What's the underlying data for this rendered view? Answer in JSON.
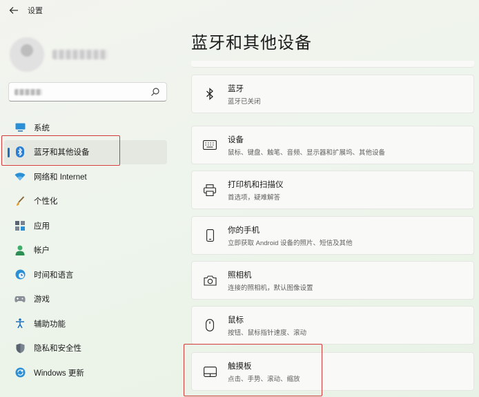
{
  "window": {
    "title": "设置"
  },
  "colors": {
    "accent": "#1f6fbf",
    "highlight": "#d23a3a"
  },
  "sidebar": {
    "profile": {
      "name": "·· :·:·.·.. ·",
      "avatar_icon": "user-avatar-icon"
    },
    "search": {
      "value": "··:·.·.··",
      "icon": "search-icon"
    },
    "items": [
      {
        "label": "系统",
        "icon": "display-icon",
        "active": false
      },
      {
        "label": "蓝牙和其他设备",
        "icon": "bluetooth-icon",
        "active": true
      },
      {
        "label": "网络和 Internet",
        "icon": "wifi-icon",
        "active": false
      },
      {
        "label": "个性化",
        "icon": "brush-icon",
        "active": false
      },
      {
        "label": "应用",
        "icon": "apps-icon",
        "active": false
      },
      {
        "label": "帐户",
        "icon": "account-icon",
        "active": false
      },
      {
        "label": "时间和语言",
        "icon": "globe-clock-icon",
        "active": false
      },
      {
        "label": "游戏",
        "icon": "gamepad-icon",
        "active": false
      },
      {
        "label": "辅助功能",
        "icon": "accessibility-icon",
        "active": false
      },
      {
        "label": "隐私和安全性",
        "icon": "shield-icon",
        "active": false
      },
      {
        "label": "Windows 更新",
        "icon": "update-icon",
        "active": false
      }
    ]
  },
  "main": {
    "title": "蓝牙和其他设备",
    "cards": [
      {
        "title": "蓝牙",
        "subtitle": "蓝牙已关闭",
        "icon": "bluetooth-icon"
      },
      {
        "title": "设备",
        "subtitle": "鼠标、键盘、触笔、音频、显示器和扩展坞、其他设备",
        "icon": "keyboard-icon"
      },
      {
        "title": "打印机和扫描仪",
        "subtitle": "首选项，疑难解答",
        "icon": "printer-icon"
      },
      {
        "title": "你的手机",
        "subtitle": "立即获取 Android 设备的照片、短信及其他",
        "icon": "phone-icon"
      },
      {
        "title": "照相机",
        "subtitle": "连接的照相机，默认图像设置",
        "icon": "camera-icon"
      },
      {
        "title": "鼠标",
        "subtitle": "按钮、鼠标指针速度、滚动",
        "icon": "mouse-icon"
      },
      {
        "title": "触摸板",
        "subtitle": "点击、手势、滚动、缩放",
        "icon": "touchpad-icon"
      }
    ]
  }
}
